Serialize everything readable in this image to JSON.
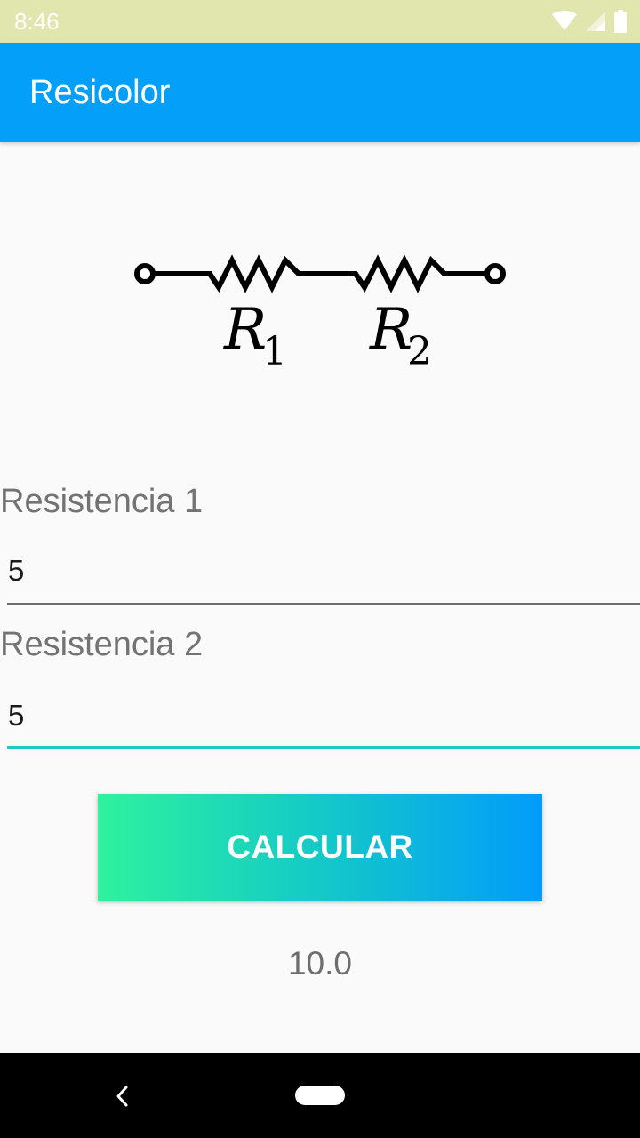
{
  "status_bar": {
    "time": "8:46",
    "icons": [
      "wifi-icon",
      "signal-icon",
      "battery-icon"
    ]
  },
  "app_bar": {
    "title": "Resicolor",
    "color": "#039ff8"
  },
  "circuit": {
    "r1": "R",
    "r1_sub": "1",
    "r2": "R",
    "r2_sub": "2"
  },
  "form": {
    "resistance1": {
      "label": "Resistencia 1",
      "value": "5"
    },
    "resistance2": {
      "label": "Resistencia 2",
      "value": "5"
    }
  },
  "button": {
    "label": "CALCULAR"
  },
  "result": {
    "value": "10.0"
  },
  "nav_bar": {
    "icons": [
      "back-icon",
      "home-pill-icon"
    ]
  },
  "colors": {
    "accent": "#1cc9c3",
    "status_bar": "#e0e6ae",
    "gradient_start": "#2ef29e",
    "gradient_end": "#029cfb"
  }
}
